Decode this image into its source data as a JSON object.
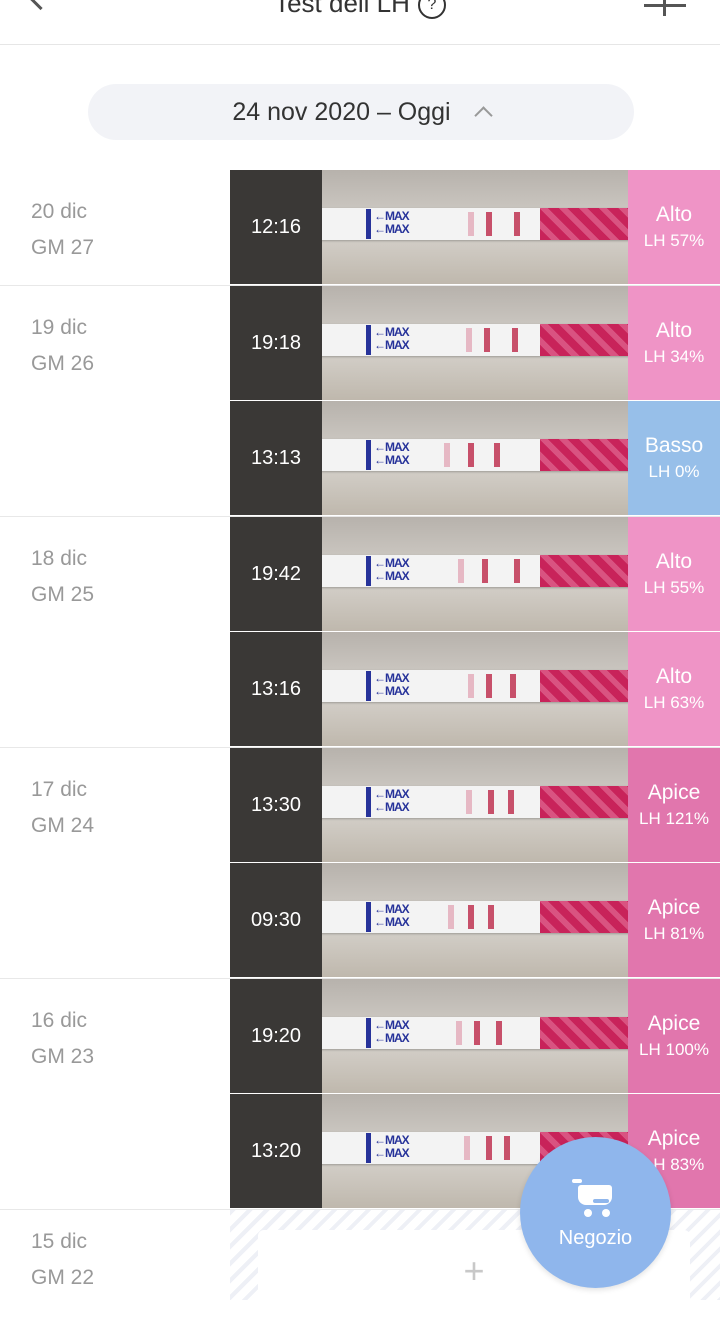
{
  "header": {
    "title": "Test dell LH",
    "help_icon": "help-circle-icon",
    "back_icon": "chevron-left-icon",
    "add_icon": "plus-icon"
  },
  "date_range": {
    "label": "24 nov 2020 – Oggi",
    "icon": "chevron-up-icon"
  },
  "colors": {
    "alto": "#ef94c6",
    "basso": "#97bfe9",
    "apice": "#e176ad",
    "accent": "#8fb6ec"
  },
  "days": [
    {
      "date": "20 dic",
      "cycle_day": "GM 27",
      "tests": [
        {
          "time": "12:16",
          "level": "Alto",
          "lh": "LH 57%",
          "kind": "alto"
        }
      ]
    },
    {
      "date": "19 dic",
      "cycle_day": "GM 26",
      "tests": [
        {
          "time": "19:18",
          "level": "Alto",
          "lh": "LH 34%",
          "kind": "alto"
        },
        {
          "time": "13:13",
          "level": "Basso",
          "lh": "LH 0%",
          "kind": "basso"
        }
      ]
    },
    {
      "date": "18 dic",
      "cycle_day": "GM 25",
      "tests": [
        {
          "time": "19:42",
          "level": "Alto",
          "lh": "LH 55%",
          "kind": "alto"
        },
        {
          "time": "13:16",
          "level": "Alto",
          "lh": "LH 63%",
          "kind": "alto"
        }
      ]
    },
    {
      "date": "17 dic",
      "cycle_day": "GM 24",
      "tests": [
        {
          "time": "13:30",
          "level": "Apice",
          "lh": "LH 121%",
          "kind": "apice"
        },
        {
          "time": "09:30",
          "level": "Apice",
          "lh": "LH 81%",
          "kind": "apice"
        }
      ]
    },
    {
      "date": "16 dic",
      "cycle_day": "GM 23",
      "tests": [
        {
          "time": "19:20",
          "level": "Apice",
          "lh": "LH 100%",
          "kind": "apice"
        },
        {
          "time": "13:20",
          "level": "Apice",
          "lh": "LH 83%",
          "kind": "apice"
        }
      ]
    }
  ],
  "empty_day": {
    "date": "15 dic",
    "cycle_day": "GM 22",
    "add_label": "+"
  },
  "strip_text": "⟵MAX\n⟵MAX",
  "shop": {
    "label": "Negozio",
    "icon": "shopping-cart-icon"
  }
}
